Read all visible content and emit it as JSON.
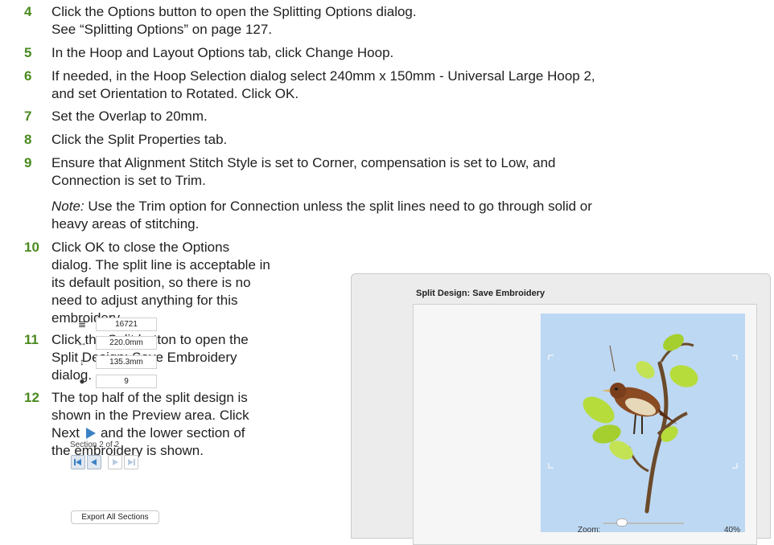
{
  "steps": [
    {
      "num": "4",
      "lines": [
        "Click the Options button to open the Splitting Options dialog.",
        "See “Splitting Options” on page 127."
      ]
    },
    {
      "num": "5",
      "lines": [
        "In the Hoop and Layout Options tab, click Change Hoop."
      ]
    },
    {
      "num": "6",
      "lines": [
        "If needed, in the Hoop Selection dialog select 240mm x 150mm - Universal Large Hoop 2,",
        "and set Orientation to Rotated. Click OK."
      ]
    },
    {
      "num": "7",
      "lines": [
        "Set the Overlap to 20mm."
      ]
    },
    {
      "num": "8",
      "lines": [
        "Click the Split Properties tab."
      ]
    },
    {
      "num": "9",
      "lines": [
        "Ensure that Alignment Stitch Style is set to Corner, compensation is set to Low, and",
        "Connection is set to Trim."
      ]
    },
    {
      "num": "10",
      "lines": [
        "Click OK to close the Options",
        "dialog. The split line is acceptable in",
        "its default position, so there is no",
        "need to adjust anything for this",
        "embroidery."
      ]
    },
    {
      "num": "11",
      "lines": [
        "Click the Split button to open the",
        "Split Design: Save Embroidery",
        "dialog."
      ]
    },
    {
      "num": "12",
      "lines": [
        "The top half of the split design is",
        "shown in the Preview area. Click"
      ],
      "next_before": "Next",
      "next_after": "and the lower section of",
      "last_line": "the embroidery is shown."
    }
  ],
  "note": {
    "label": "Note:",
    "line1": "Use the Trim option for Connection unless the split lines need to go through solid or",
    "line2": "heavy areas of stitching."
  },
  "dialog": {
    "title": "Split Design: Save Embroidery",
    "stitches": "16721",
    "width": "220.0mm",
    "height": "135.3mm",
    "colors": "9",
    "section_label": "Section 2 of 2",
    "export_label": "Export All Sections",
    "zoom_label": "Zoom:",
    "zoom_value": "40%"
  },
  "colors": {
    "step_number": "#4a8a1f",
    "preview_bg": "#bdd8f2",
    "nav_blue": "#3b82c4",
    "leaf": "#b6dc3c",
    "branch": "#6b4a2a",
    "bird_body": "#8a4a22"
  },
  "icons": [
    "stitch-count-icon",
    "width-icon",
    "height-icon",
    "palette-icon",
    "first-section-icon",
    "previous-section-icon",
    "next-section-icon",
    "last-section-icon",
    "next-arrow-icon"
  ]
}
